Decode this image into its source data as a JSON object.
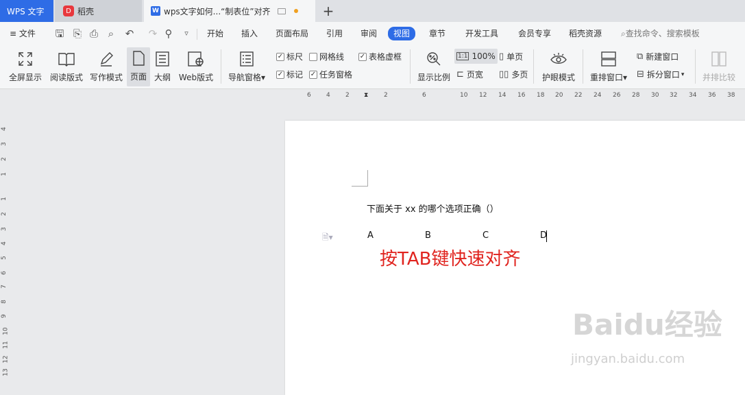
{
  "tabs": {
    "wps": "WPS 文字",
    "daoke": "稻壳",
    "doc": "wps文字如何...“制表位”对齐",
    "add": "+"
  },
  "menu": {
    "file": "文件",
    "items": [
      "开始",
      "插入",
      "页面布局",
      "引用",
      "审阅",
      "视图",
      "章节",
      "开发工具",
      "会员专享",
      "稻壳资源"
    ],
    "active": "视图",
    "search": "查找命令、搜索模板"
  },
  "ribbon": {
    "big": [
      "全屏显示",
      "阅读版式",
      "写作模式",
      "页面",
      "大纲",
      "Web版式",
      "导航窗格",
      "显示比例",
      "护眼模式",
      "重排窗口",
      "并排比较"
    ],
    "checks": [
      {
        "label": "标尺",
        "checked": true
      },
      {
        "label": "网格线",
        "checked": false
      },
      {
        "label": "表格虚框",
        "checked": true
      },
      {
        "label": "标记",
        "checked": true
      },
      {
        "label": "任务窗格",
        "checked": true
      }
    ],
    "zoom": "100%",
    "single": "单页",
    "pagewidth": "页宽",
    "multi": "多页",
    "newwin": "新建窗口",
    "split": "拆分窗口"
  },
  "ruler": {
    "top": [
      "6",
      "4",
      "2",
      "2",
      "6",
      "10",
      "12",
      "14",
      "16",
      "18",
      "20",
      "22",
      "24",
      "26",
      "28",
      "30",
      "32",
      "34",
      "36",
      "38"
    ],
    "left": [
      "4",
      "3",
      "2",
      "1",
      "1",
      "2",
      "3",
      "4",
      "5",
      "6",
      "7",
      "8",
      "9",
      "10",
      "11",
      "12",
      "13"
    ]
  },
  "doc": {
    "question": "下面关于 xx 的哪个选项正确（）",
    "options": [
      "A",
      "B",
      "C",
      "D"
    ],
    "annotation": "按TAB键快速对齐"
  },
  "watermark": {
    "brand": "Baidu经验",
    "url": "jingyan.baidu.com"
  }
}
